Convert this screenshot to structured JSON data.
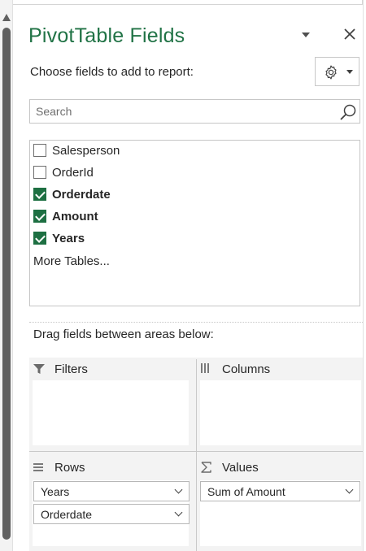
{
  "panel": {
    "title": "PivotTable Fields",
    "subtitle": "Choose fields to add to report:",
    "search_placeholder": "Search",
    "more_tables": "More Tables...",
    "drag_instruction": "Drag fields between areas below:"
  },
  "fields": [
    {
      "label": "Salesperson",
      "checked": false
    },
    {
      "label": "OrderId",
      "checked": false
    },
    {
      "label": "Orderdate",
      "checked": true
    },
    {
      "label": "Amount",
      "checked": true
    },
    {
      "label": "Years",
      "checked": true
    }
  ],
  "areas": {
    "filters": {
      "label": "Filters",
      "items": []
    },
    "columns": {
      "label": "Columns",
      "items": []
    },
    "rows": {
      "label": "Rows",
      "items": [
        "Years",
        "Orderdate"
      ]
    },
    "values": {
      "label": "Values",
      "items": [
        "Sum of Amount"
      ]
    }
  },
  "colors": {
    "accent": "#217346",
    "checkbox": "#1d6f42",
    "area_bg": "#f3f3f3"
  },
  "icons": {
    "close": "close-icon",
    "settings": "gear-icon",
    "search": "search-icon",
    "filters": "filter-icon",
    "columns": "columns-icon",
    "rows": "rows-icon",
    "values": "sigma-icon"
  }
}
